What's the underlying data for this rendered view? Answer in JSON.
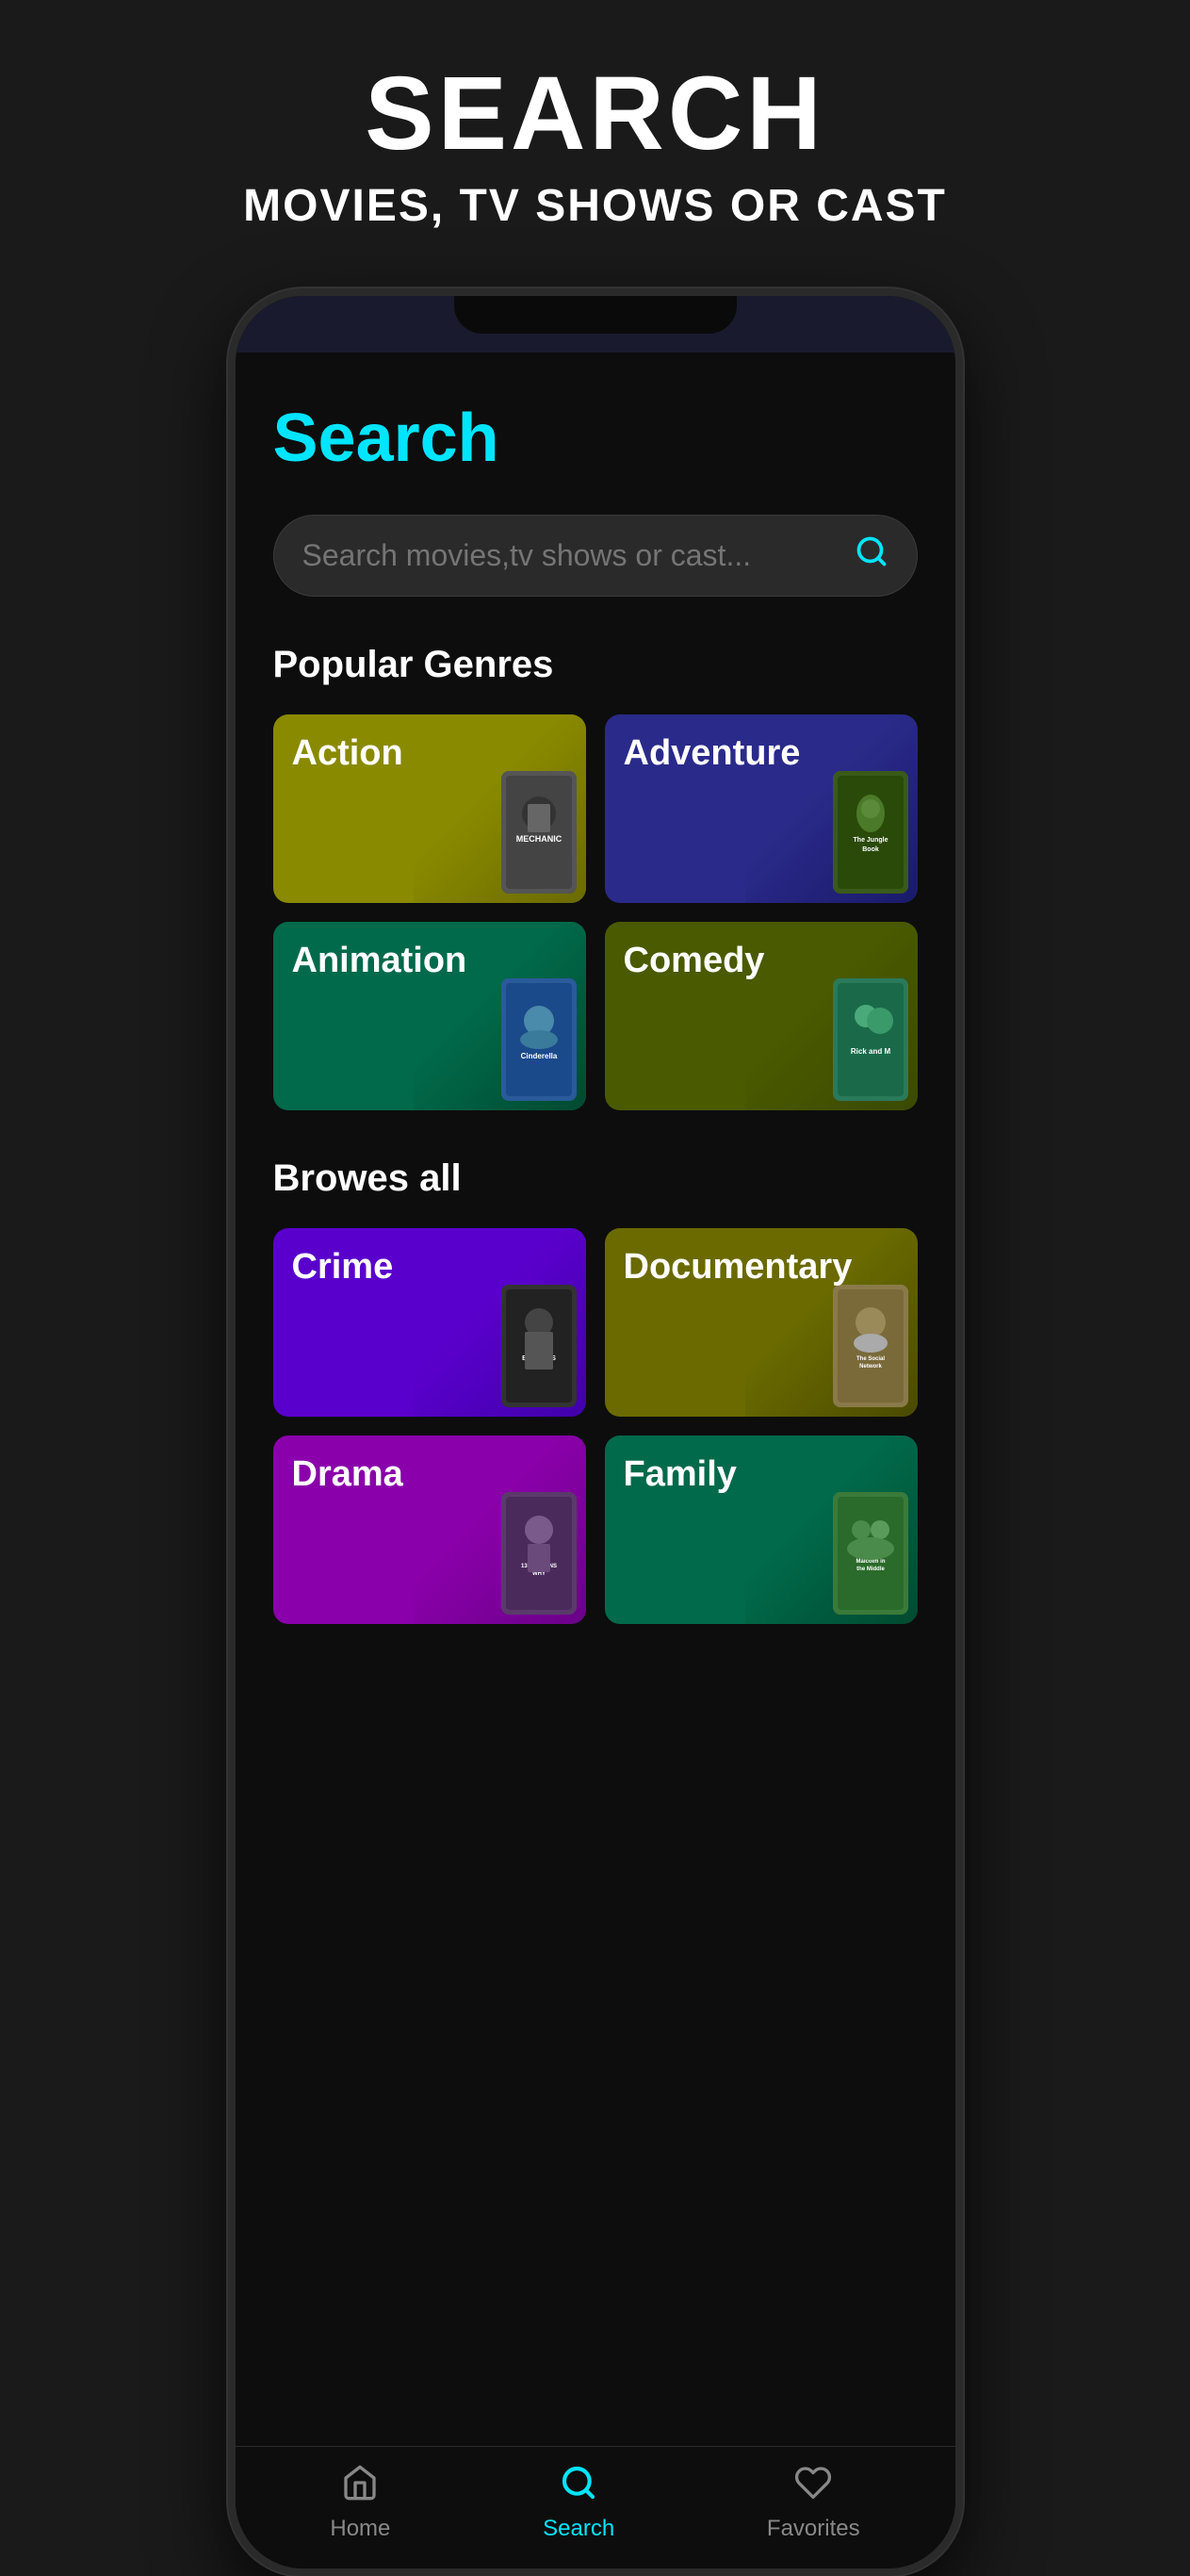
{
  "header": {
    "title": "SEARCH",
    "subtitle": "MOVIES, TV SHOWS OR CAST"
  },
  "app": {
    "search_heading": "Search",
    "search_placeholder": "Search movies,tv shows or cast...",
    "popular_genres_title": "Popular Genres",
    "browse_all_title": "Browes all",
    "genres_popular": [
      {
        "id": "action",
        "label": "Action",
        "color": "#7a7a00",
        "poster_title": "MECHANIC"
      },
      {
        "id": "adventure",
        "label": "Adventure",
        "color": "#2a2a8a",
        "poster_title": "The Jungle Book"
      },
      {
        "id": "animation",
        "label": "Animation",
        "color": "#006a4a",
        "poster_title": "Cinderella"
      },
      {
        "id": "comedy",
        "label": "Comedy",
        "color": "#4a5a00",
        "poster_title": "Rick and M..."
      }
    ],
    "genres_all": [
      {
        "id": "crime",
        "label": "Crime",
        "color": "#5500cc",
        "poster_title": "PEAKY BLINDERS"
      },
      {
        "id": "documentary",
        "label": "Documentary",
        "color": "#6a6a00",
        "poster_title": "The Social Network"
      },
      {
        "id": "drama",
        "label": "Drama",
        "color": "#8800aa",
        "poster_title": "13 Reasons Why"
      },
      {
        "id": "family",
        "label": "Family",
        "color": "#006a4a",
        "poster_title": "Malcolm in the Middle"
      }
    ]
  },
  "bottom_nav": {
    "items": [
      {
        "id": "home",
        "label": "Home",
        "active": false
      },
      {
        "id": "search",
        "label": "Search",
        "active": true
      },
      {
        "id": "favorites",
        "label": "Favorites",
        "active": false
      }
    ]
  }
}
